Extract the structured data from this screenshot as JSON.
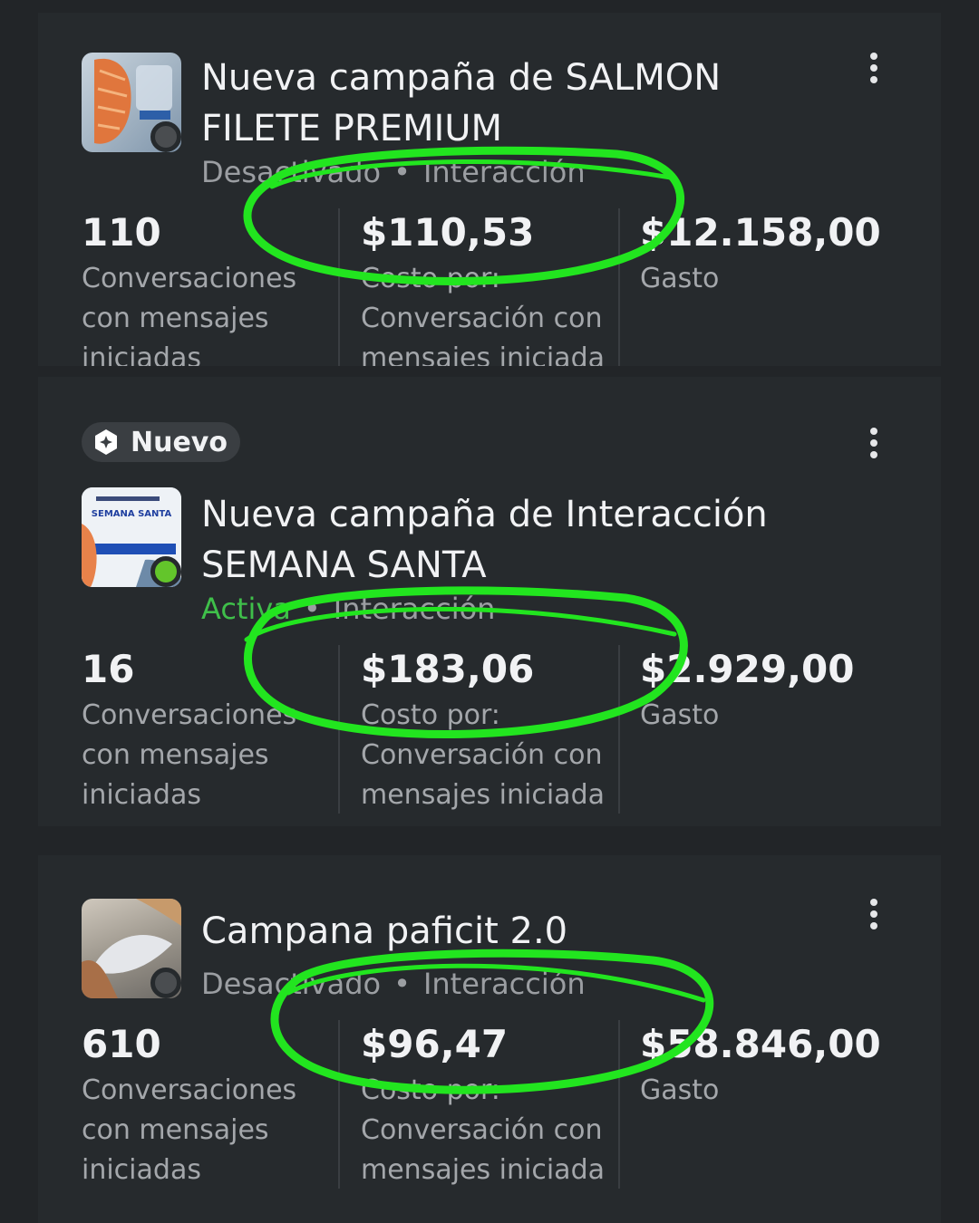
{
  "campaigns": [
    {
      "title_line1": "Nueva campaña de SALMON",
      "title_line2": "FILETE PREMIUM",
      "status": "Desactivado",
      "separator": "•",
      "objective": "Interacción",
      "status_color": "#9b9ea2",
      "dot_color": "#4a4d50",
      "results_value": "110",
      "results_label": "Conversaciones\ncon mensajes\niniciadas",
      "cost_value": "$110,53",
      "cost_label": "Costo por:\nConversación con\nmensajes iniciada",
      "spend_value": "$12.158,00",
      "spend_label": "Gasto"
    },
    {
      "badge": "Nuevo",
      "title_line1": "Nueva campaña de Interacción",
      "title_line2": "SEMANA SANTA",
      "status": "Activa",
      "separator": "•",
      "objective": "Interacción",
      "status_color": "#3fbf4a",
      "dot_color": "#63c52b",
      "results_value": "16",
      "results_label": "Conversaciones\ncon mensajes\niniciadas",
      "cost_value": "$183,06",
      "cost_label": "Costo por:\nConversación con\nmensajes iniciada",
      "spend_value": "$2.929,00",
      "spend_label": "Gasto"
    },
    {
      "title_line1": "Campana paficit 2.0",
      "status": "Desactivado",
      "separator": "•",
      "objective": "Interacción",
      "status_color": "#9b9ea2",
      "dot_color": "#4a4d50",
      "results_value": "610",
      "results_label": "Conversaciones\ncon mensajes\niniciadas",
      "cost_value": "$96,47",
      "cost_label": "Costo por:\nConversación con\nmensajes iniciada",
      "spend_value": "$58.846,00",
      "spend_label": "Gasto"
    }
  ],
  "thumbnails": [
    {
      "icon": "salmon-fillet-image",
      "thumb_text": ""
    },
    {
      "icon": "semana-santa-flyer-image",
      "thumb_text": "SEMANA SANTA"
    },
    {
      "icon": "fish-photo-image",
      "thumb_text": ""
    }
  ],
  "annotation_color": "#22e51f"
}
